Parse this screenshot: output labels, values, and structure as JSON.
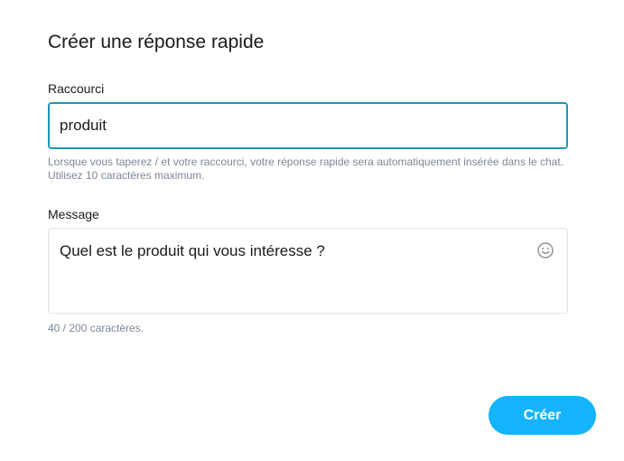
{
  "dialog": {
    "title": "Créer une réponse rapide"
  },
  "shortcut": {
    "label": "Raccourci",
    "value": "produit",
    "hint": "Lorsque vous taperez / et votre raccourci, votre réponse rapide sera automatiquement insérée dans le chat. Utilisez 10 caractères maximum."
  },
  "message": {
    "label": "Message",
    "value": "Quel est le produit qui vous intéresse ?",
    "emoji_icon": "smiley-icon",
    "counter": "40 / 200 caractères."
  },
  "actions": {
    "create_label": "Créer"
  },
  "colors": {
    "accent": "#14b4ff",
    "focus_border": "#1b97b8",
    "hint_text": "#7b8794"
  }
}
